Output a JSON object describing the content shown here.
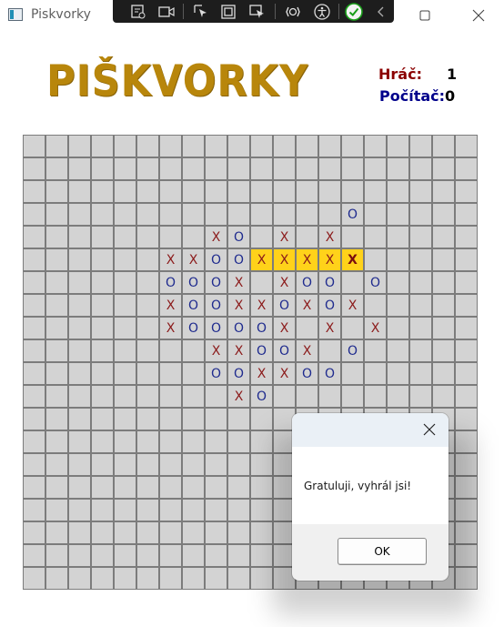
{
  "window": {
    "title": "Piskvorky"
  },
  "header": {
    "logo": "PIŠKVORKY",
    "player_label": "Hráč:",
    "player_score": "1",
    "computer_label": "Počítač:",
    "computer_score": "0",
    "player_color": "#8b0000",
    "computer_color": "#00008b"
  },
  "board": {
    "size": 20,
    "moves": [
      {
        "row": 3,
        "col": 14,
        "mark": "O"
      },
      {
        "row": 4,
        "col": 8,
        "mark": "X"
      },
      {
        "row": 4,
        "col": 9,
        "mark": "O"
      },
      {
        "row": 4,
        "col": 11,
        "mark": "X"
      },
      {
        "row": 4,
        "col": 13,
        "mark": "X"
      },
      {
        "row": 5,
        "col": 6,
        "mark": "X"
      },
      {
        "row": 5,
        "col": 7,
        "mark": "X"
      },
      {
        "row": 5,
        "col": 8,
        "mark": "O"
      },
      {
        "row": 5,
        "col": 9,
        "mark": "O"
      },
      {
        "row": 5,
        "col": 10,
        "mark": "X",
        "win": true
      },
      {
        "row": 5,
        "col": 11,
        "mark": "X",
        "win": true
      },
      {
        "row": 5,
        "col": 12,
        "mark": "X",
        "win": true
      },
      {
        "row": 5,
        "col": 13,
        "mark": "X",
        "win": true
      },
      {
        "row": 5,
        "col": 14,
        "mark": "X",
        "win": true,
        "last": true
      },
      {
        "row": 6,
        "col": 6,
        "mark": "O"
      },
      {
        "row": 6,
        "col": 7,
        "mark": "O"
      },
      {
        "row": 6,
        "col": 8,
        "mark": "O"
      },
      {
        "row": 6,
        "col": 9,
        "mark": "X"
      },
      {
        "row": 6,
        "col": 11,
        "mark": "X"
      },
      {
        "row": 6,
        "col": 12,
        "mark": "O"
      },
      {
        "row": 6,
        "col": 13,
        "mark": "O"
      },
      {
        "row": 6,
        "col": 15,
        "mark": "O"
      },
      {
        "row": 7,
        "col": 6,
        "mark": "X"
      },
      {
        "row": 7,
        "col": 7,
        "mark": "O"
      },
      {
        "row": 7,
        "col": 8,
        "mark": "O"
      },
      {
        "row": 7,
        "col": 9,
        "mark": "X"
      },
      {
        "row": 7,
        "col": 10,
        "mark": "X"
      },
      {
        "row": 7,
        "col": 11,
        "mark": "O"
      },
      {
        "row": 7,
        "col": 12,
        "mark": "X"
      },
      {
        "row": 7,
        "col": 13,
        "mark": "O"
      },
      {
        "row": 7,
        "col": 14,
        "mark": "X"
      },
      {
        "row": 8,
        "col": 6,
        "mark": "X"
      },
      {
        "row": 8,
        "col": 7,
        "mark": "O"
      },
      {
        "row": 8,
        "col": 8,
        "mark": "O"
      },
      {
        "row": 8,
        "col": 9,
        "mark": "O"
      },
      {
        "row": 8,
        "col": 10,
        "mark": "O"
      },
      {
        "row": 8,
        "col": 11,
        "mark": "X"
      },
      {
        "row": 8,
        "col": 13,
        "mark": "X"
      },
      {
        "row": 8,
        "col": 15,
        "mark": "X"
      },
      {
        "row": 9,
        "col": 8,
        "mark": "X"
      },
      {
        "row": 9,
        "col": 9,
        "mark": "X"
      },
      {
        "row": 9,
        "col": 10,
        "mark": "O"
      },
      {
        "row": 9,
        "col": 11,
        "mark": "O"
      },
      {
        "row": 9,
        "col": 12,
        "mark": "X"
      },
      {
        "row": 9,
        "col": 14,
        "mark": "O"
      },
      {
        "row": 10,
        "col": 8,
        "mark": "O"
      },
      {
        "row": 10,
        "col": 9,
        "mark": "O"
      },
      {
        "row": 10,
        "col": 10,
        "mark": "X"
      },
      {
        "row": 10,
        "col": 11,
        "mark": "X"
      },
      {
        "row": 10,
        "col": 12,
        "mark": "O"
      },
      {
        "row": 10,
        "col": 13,
        "mark": "O"
      },
      {
        "row": 11,
        "col": 9,
        "mark": "X"
      },
      {
        "row": 11,
        "col": 10,
        "mark": "O"
      }
    ]
  },
  "dialog": {
    "message": "Gratuluji, vyhrál jsi!",
    "ok_label": "OK"
  }
}
